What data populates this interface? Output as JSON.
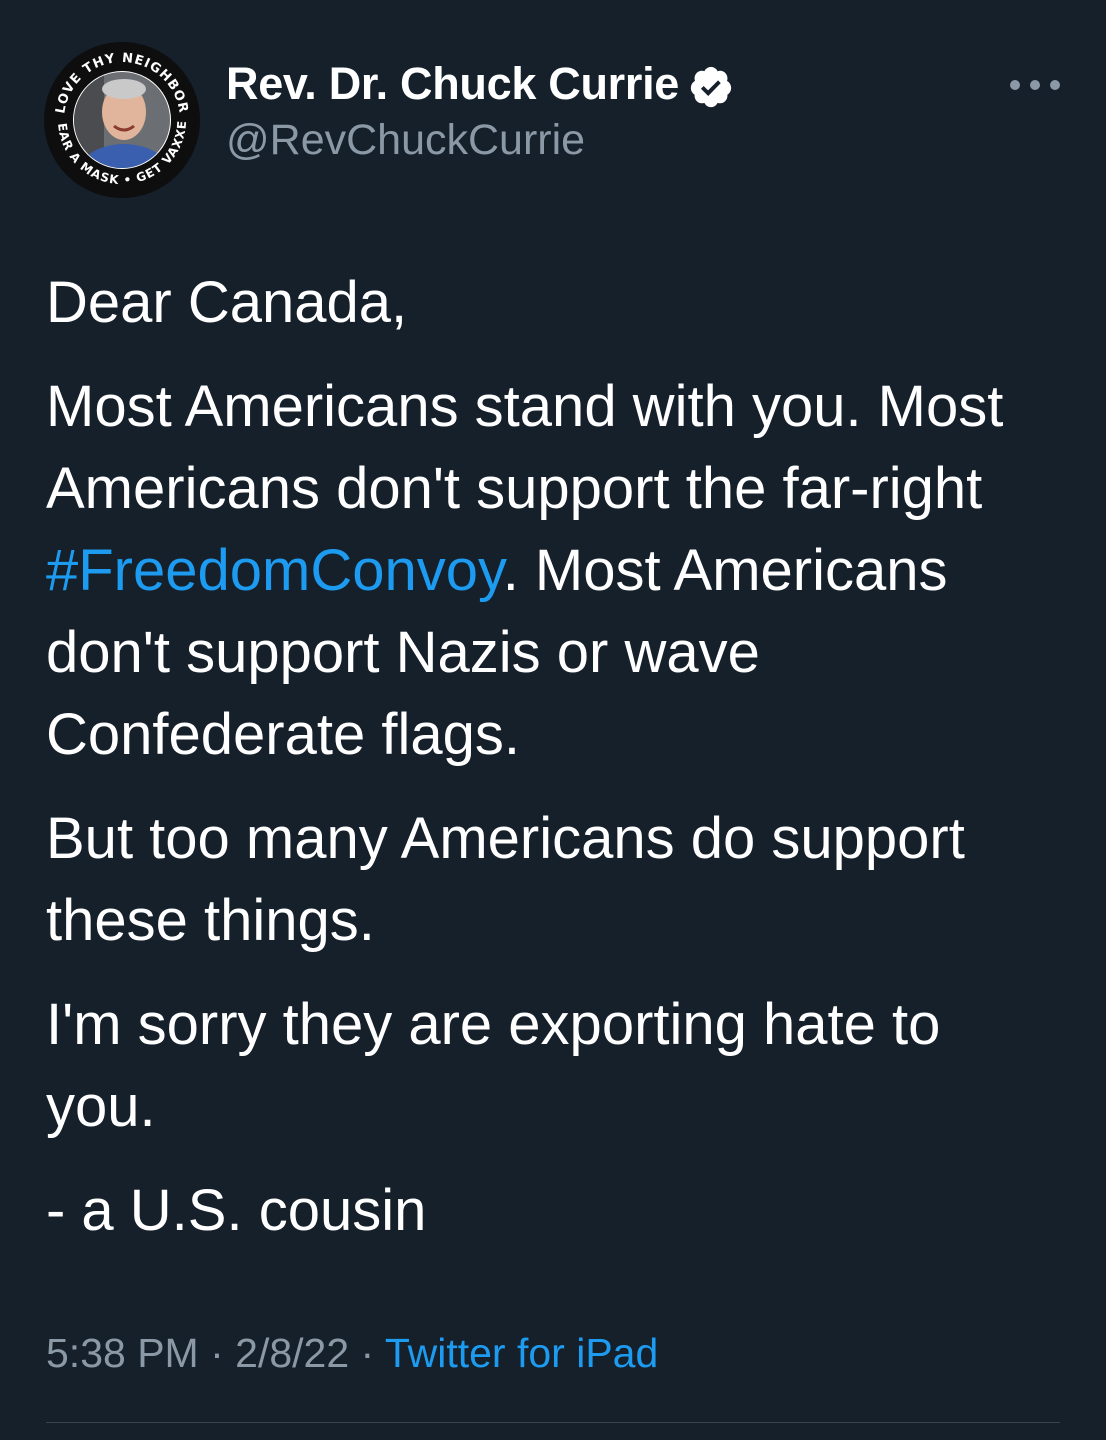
{
  "author": {
    "display_name": "Rev. Dr. Chuck Currie",
    "handle": "@RevChuckCurrie",
    "verified": true,
    "avatar_ring_text_top": "LOVE THY NEIGHBOR",
    "avatar_ring_text_bottom": "WEAR A MASK • GET VAXXED"
  },
  "tweet": {
    "greeting": "Dear Canada,",
    "p2_before": "Most Americans stand with you. Most Americans don't support the far-right ",
    "hashtag": "#FreedomConvoy",
    "p2_after": ". Most Americans don't support Nazis or wave Confederate flags.",
    "p3": "But too many Americans do support these things.",
    "p4": "I'm sorry they are exporting hate to you.",
    "signoff": "- a U.S. cousin"
  },
  "meta": {
    "time": "5:38 PM",
    "separator": " · ",
    "date": "2/8/22",
    "source": "Twitter for iPad"
  },
  "colors": {
    "background": "#15202b",
    "accent": "#1d9bf0",
    "secondary_text": "#8b98a5"
  }
}
